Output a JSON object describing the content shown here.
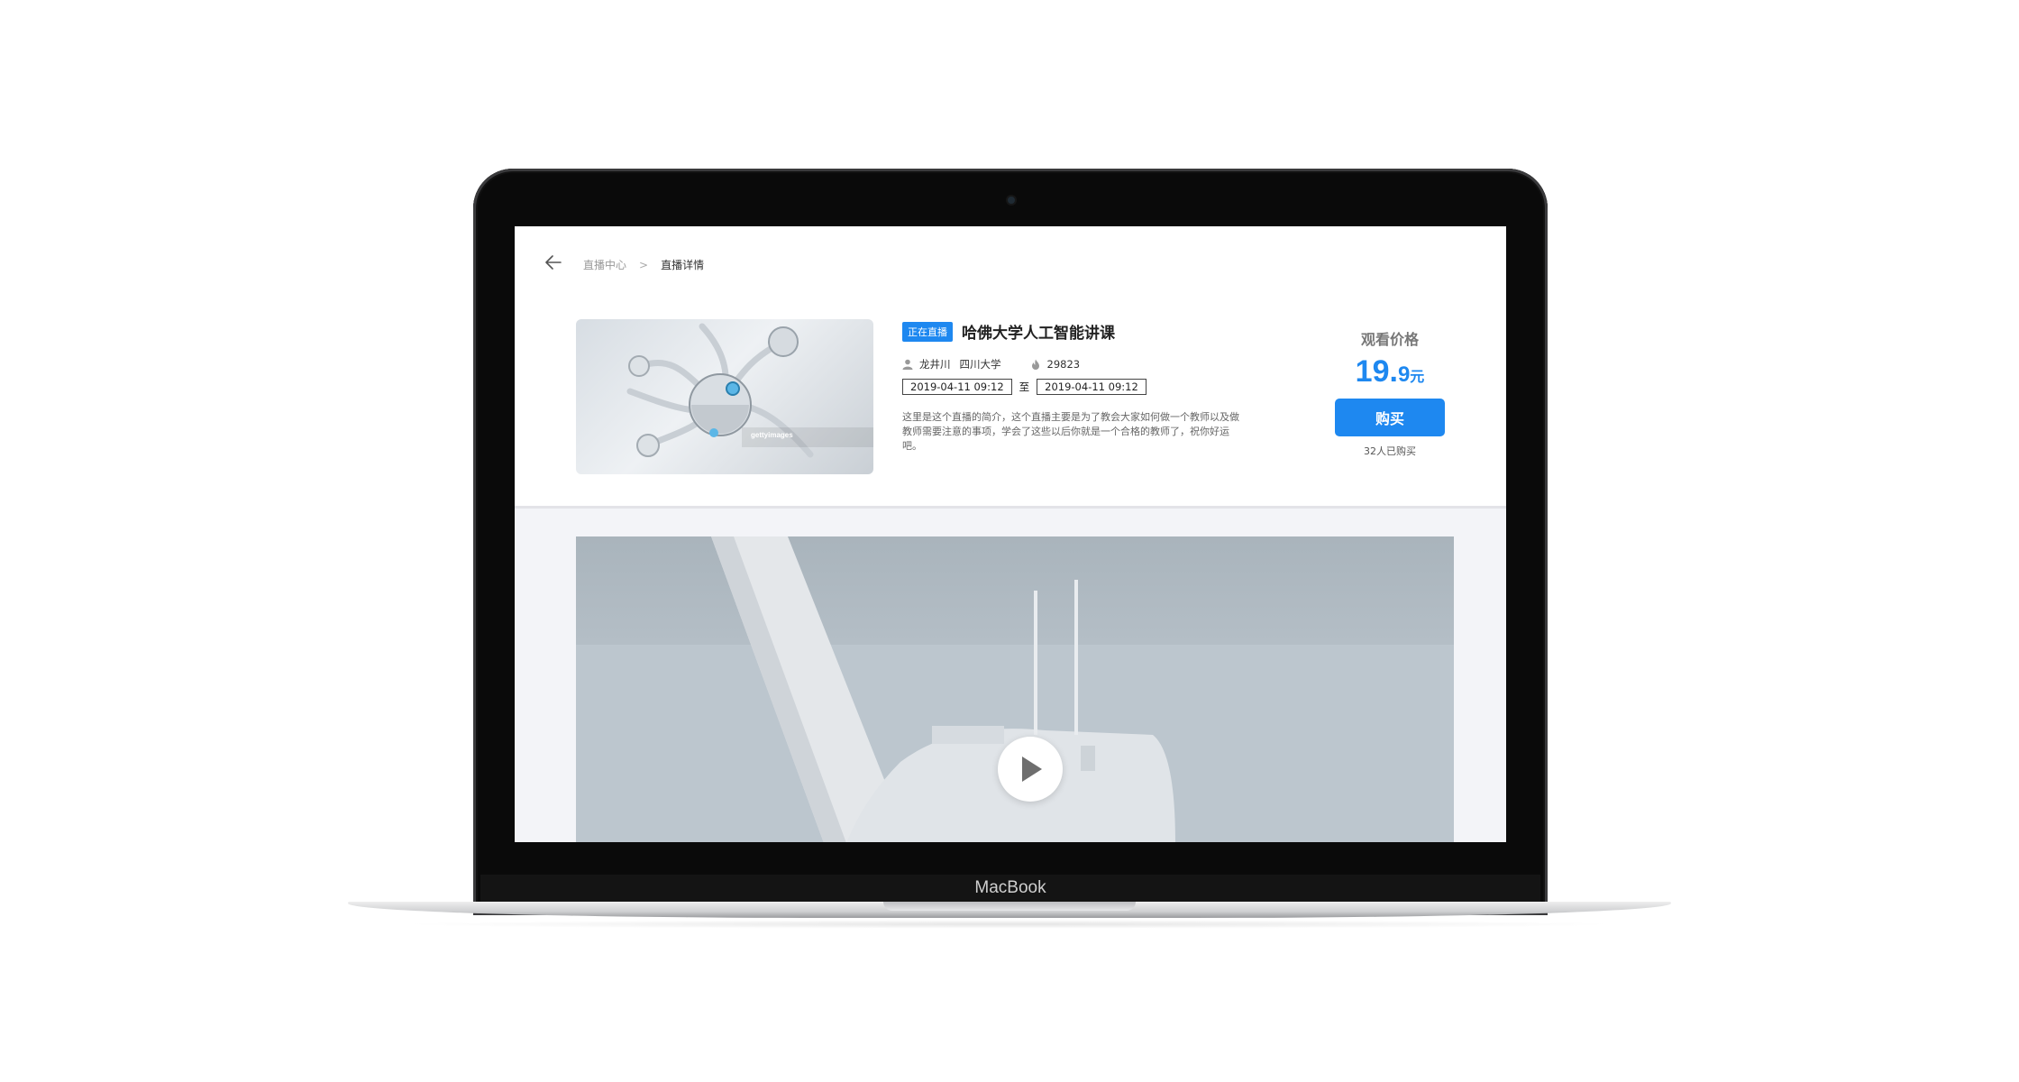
{
  "device": {
    "brand_label": "MacBook"
  },
  "breadcrumb": {
    "parent": "直播中心",
    "separator": ">",
    "current": "直播详情"
  },
  "course": {
    "badge": "正在直播",
    "title": "哈佛大学人工智能讲课",
    "teacher": "龙井川",
    "school": "四川大学",
    "views": "29823",
    "start_time": "2019-04-11 09:12",
    "time_separator": "至",
    "end_time": "2019-04-11 09:12",
    "description": "这里是这个直播的简介，这个直播主要是为了教会大家如何做一个教师以及做教师需要注意的事项，学会了这些以后你就是一个合格的教师了，祝你好运吧。",
    "thumbnail_watermark": "gettyimages"
  },
  "pricing": {
    "label": "观看价格",
    "price_int": "19.",
    "price_dec": "9",
    "unit": "元",
    "buy_label": "购买",
    "sold_text": "32人已购买"
  },
  "colors": {
    "accent": "#1e88f0",
    "page_bg": "#f3f4f8"
  },
  "icons": [
    "back-arrow-icon",
    "user-icon",
    "fire-icon",
    "play-icon"
  ]
}
